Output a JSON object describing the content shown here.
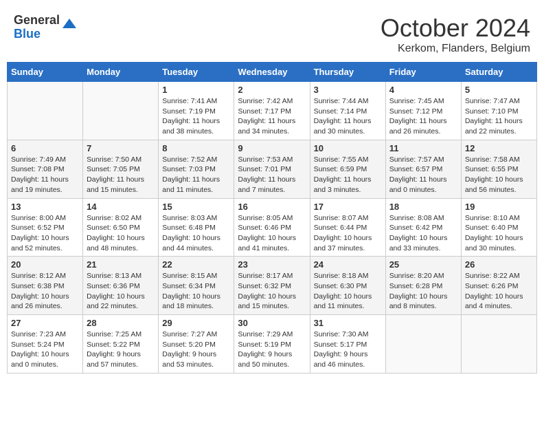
{
  "logo": {
    "general": "General",
    "blue": "Blue"
  },
  "title": {
    "month": "October 2024",
    "location": "Kerkom, Flanders, Belgium"
  },
  "calendar": {
    "headers": [
      "Sunday",
      "Monday",
      "Tuesday",
      "Wednesday",
      "Thursday",
      "Friday",
      "Saturday"
    ],
    "rows": [
      [
        {
          "day": "",
          "info": ""
        },
        {
          "day": "",
          "info": ""
        },
        {
          "day": "1",
          "info": "Sunrise: 7:41 AM\nSunset: 7:19 PM\nDaylight: 11 hours and 38 minutes."
        },
        {
          "day": "2",
          "info": "Sunrise: 7:42 AM\nSunset: 7:17 PM\nDaylight: 11 hours and 34 minutes."
        },
        {
          "day": "3",
          "info": "Sunrise: 7:44 AM\nSunset: 7:14 PM\nDaylight: 11 hours and 30 minutes."
        },
        {
          "day": "4",
          "info": "Sunrise: 7:45 AM\nSunset: 7:12 PM\nDaylight: 11 hours and 26 minutes."
        },
        {
          "day": "5",
          "info": "Sunrise: 7:47 AM\nSunset: 7:10 PM\nDaylight: 11 hours and 22 minutes."
        }
      ],
      [
        {
          "day": "6",
          "info": "Sunrise: 7:49 AM\nSunset: 7:08 PM\nDaylight: 11 hours and 19 minutes."
        },
        {
          "day": "7",
          "info": "Sunrise: 7:50 AM\nSunset: 7:05 PM\nDaylight: 11 hours and 15 minutes."
        },
        {
          "day": "8",
          "info": "Sunrise: 7:52 AM\nSunset: 7:03 PM\nDaylight: 11 hours and 11 minutes."
        },
        {
          "day": "9",
          "info": "Sunrise: 7:53 AM\nSunset: 7:01 PM\nDaylight: 11 hours and 7 minutes."
        },
        {
          "day": "10",
          "info": "Sunrise: 7:55 AM\nSunset: 6:59 PM\nDaylight: 11 hours and 3 minutes."
        },
        {
          "day": "11",
          "info": "Sunrise: 7:57 AM\nSunset: 6:57 PM\nDaylight: 11 hours and 0 minutes."
        },
        {
          "day": "12",
          "info": "Sunrise: 7:58 AM\nSunset: 6:55 PM\nDaylight: 10 hours and 56 minutes."
        }
      ],
      [
        {
          "day": "13",
          "info": "Sunrise: 8:00 AM\nSunset: 6:52 PM\nDaylight: 10 hours and 52 minutes."
        },
        {
          "day": "14",
          "info": "Sunrise: 8:02 AM\nSunset: 6:50 PM\nDaylight: 10 hours and 48 minutes."
        },
        {
          "day": "15",
          "info": "Sunrise: 8:03 AM\nSunset: 6:48 PM\nDaylight: 10 hours and 44 minutes."
        },
        {
          "day": "16",
          "info": "Sunrise: 8:05 AM\nSunset: 6:46 PM\nDaylight: 10 hours and 41 minutes."
        },
        {
          "day": "17",
          "info": "Sunrise: 8:07 AM\nSunset: 6:44 PM\nDaylight: 10 hours and 37 minutes."
        },
        {
          "day": "18",
          "info": "Sunrise: 8:08 AM\nSunset: 6:42 PM\nDaylight: 10 hours and 33 minutes."
        },
        {
          "day": "19",
          "info": "Sunrise: 8:10 AM\nSunset: 6:40 PM\nDaylight: 10 hours and 30 minutes."
        }
      ],
      [
        {
          "day": "20",
          "info": "Sunrise: 8:12 AM\nSunset: 6:38 PM\nDaylight: 10 hours and 26 minutes."
        },
        {
          "day": "21",
          "info": "Sunrise: 8:13 AM\nSunset: 6:36 PM\nDaylight: 10 hours and 22 minutes."
        },
        {
          "day": "22",
          "info": "Sunrise: 8:15 AM\nSunset: 6:34 PM\nDaylight: 10 hours and 18 minutes."
        },
        {
          "day": "23",
          "info": "Sunrise: 8:17 AM\nSunset: 6:32 PM\nDaylight: 10 hours and 15 minutes."
        },
        {
          "day": "24",
          "info": "Sunrise: 8:18 AM\nSunset: 6:30 PM\nDaylight: 10 hours and 11 minutes."
        },
        {
          "day": "25",
          "info": "Sunrise: 8:20 AM\nSunset: 6:28 PM\nDaylight: 10 hours and 8 minutes."
        },
        {
          "day": "26",
          "info": "Sunrise: 8:22 AM\nSunset: 6:26 PM\nDaylight: 10 hours and 4 minutes."
        }
      ],
      [
        {
          "day": "27",
          "info": "Sunrise: 7:23 AM\nSunset: 5:24 PM\nDaylight: 10 hours and 0 minutes."
        },
        {
          "day": "28",
          "info": "Sunrise: 7:25 AM\nSunset: 5:22 PM\nDaylight: 9 hours and 57 minutes."
        },
        {
          "day": "29",
          "info": "Sunrise: 7:27 AM\nSunset: 5:20 PM\nDaylight: 9 hours and 53 minutes."
        },
        {
          "day": "30",
          "info": "Sunrise: 7:29 AM\nSunset: 5:19 PM\nDaylight: 9 hours and 50 minutes."
        },
        {
          "day": "31",
          "info": "Sunrise: 7:30 AM\nSunset: 5:17 PM\nDaylight: 9 hours and 46 minutes."
        },
        {
          "day": "",
          "info": ""
        },
        {
          "day": "",
          "info": ""
        }
      ]
    ]
  }
}
